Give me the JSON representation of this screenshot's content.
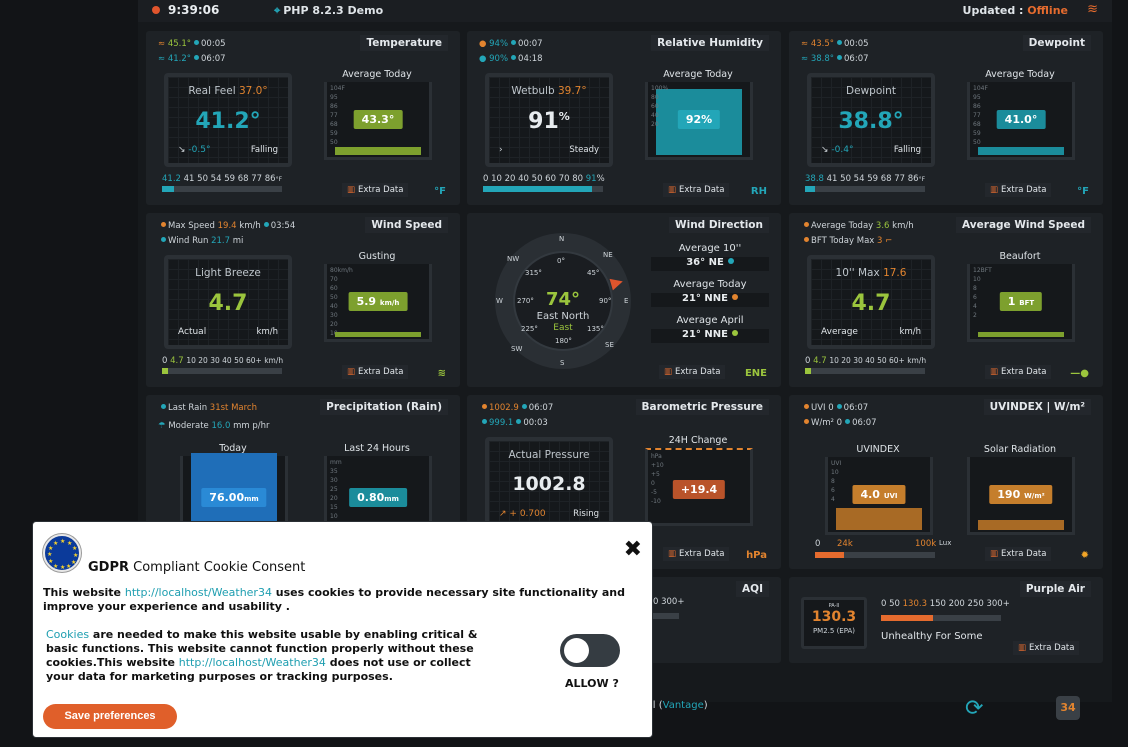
{
  "topbar": {
    "time": "9:39:06",
    "php": "PHP 8.2.3 Demo",
    "updated_label": "Updated :",
    "status": "Offline"
  },
  "temperature": {
    "title": "Temperature",
    "hi_line": "45.1°",
    "hi_time": "00:05",
    "lo_line": "41.2°",
    "lo_time": "06:07",
    "header": "Real Feel",
    "header_val": "37.0°",
    "value": "41.2°",
    "trend": "-0.5°",
    "trend_label": "Falling",
    "gauge_title": "Average Today",
    "gauge_val": "43.3°",
    "scale_pre": "41.2",
    "scale": "41 50 54 59 68 77 86",
    "scale_unit": "°F",
    "gauge_scale": [
      "104F",
      "95",
      "86",
      "77",
      "68",
      "59",
      "50"
    ],
    "fill_pct": 0.1,
    "extra": "Extra Data",
    "unit": "°F"
  },
  "humidity": {
    "title": "Relative Humidity",
    "hi_line": "94%",
    "hi_time": "00:07",
    "lo_line": "90%",
    "lo_time": "04:18",
    "header": "Wetbulb",
    "header_val": "39.7°",
    "value": "91",
    "value_unit": "%",
    "trend_label": "Steady",
    "gauge_title": "Average Today",
    "gauge_val": "92%",
    "scale": "0 10 20 40 50 60 70 80",
    "scale_val": "91",
    "scale_unit": "%",
    "gauge_scale": [
      "100%",
      "80",
      "60",
      "40",
      "20"
    ],
    "fill_pct": 0.91,
    "extra": "Extra Data",
    "unit": "RH"
  },
  "dewpoint": {
    "title": "Dewpoint",
    "hi_line": "43.5°",
    "hi_time": "00:05",
    "lo_line": "38.8°",
    "lo_time": "06:07",
    "header": "Dewpoint",
    "value": "38.8°",
    "trend": "-0.4°",
    "trend_label": "Falling",
    "gauge_title": "Average Today",
    "gauge_val": "41.0°",
    "scale_pre": "38.8",
    "scale": "41 50 54 59 68 77 86",
    "scale_unit": "°F",
    "gauge_scale": [
      "104F",
      "95",
      "86",
      "77",
      "68",
      "59",
      "50"
    ],
    "fill_pct": 0.08,
    "extra": "Extra Data",
    "unit": "°F"
  },
  "wind": {
    "title": "Wind Speed",
    "max_label": "Max Speed",
    "max_val": "19.4",
    "max_unit": "km/h",
    "max_time": "03:54",
    "run_label": "Wind Run",
    "run_val": "21.7",
    "run_unit": "mi",
    "header": "Light Breeze",
    "value": "4.7",
    "bl": "Actual",
    "br": "km/h",
    "gauge_title": "Gusting",
    "gauge_val": "5.9",
    "gauge_unit": "km/h",
    "scale_pre": "0",
    "scale_val": "4.7",
    "scale": "10 20 30 40 50 60+ km/h",
    "gauge_scale": [
      "80km/h",
      "70",
      "60",
      "50",
      "40",
      "30",
      "20",
      "10"
    ],
    "fill_pct": 0.05,
    "extra": "Extra Data"
  },
  "winddir": {
    "title": "Wind Direction",
    "degrees": "74°",
    "dir1": "East North",
    "dir2": "East",
    "points": {
      "n": "N",
      "ne": "NE",
      "e": "E",
      "se": "SE",
      "s": "S",
      "sw": "SW",
      "w": "W",
      "nw": "NW"
    },
    "degs": {
      "d0": "0°",
      "d45": "45°",
      "d90": "90°",
      "d135": "135°",
      "d180": "180°",
      "d225": "225°",
      "d270": "270°",
      "d315": "315°"
    },
    "avg10_label": "Average 10''",
    "avg10_val": "36°  NE",
    "avgtoday_label": "Average Today",
    "avgtoday_val": "21°  NNE",
    "avgapril_label": "Average April",
    "avgapril_val": "21°  NNE",
    "extra": "Extra Data",
    "unit": "ENE"
  },
  "avgwind": {
    "title": "Average Wind Speed",
    "today_label": "Average Today",
    "today_val": "3.6",
    "today_unit": "km/h",
    "bft_label": "BFT Today Max",
    "bft_val": "3",
    "header": "10'' Max",
    "header_val": "17.6",
    "value": "4.7",
    "bl": "Average",
    "br": "km/h",
    "gauge_title": "Beaufort",
    "gauge_val": "1",
    "gauge_unit": "BFT",
    "scale_pre": "0",
    "scale_val": "4.7",
    "scale": "10 20 30 40 50 60+ km/h",
    "gauge_scale": [
      "12BFT",
      "10",
      "8",
      "6",
      "4",
      "2"
    ],
    "fill_pct": 0.05,
    "extra": "Extra Data"
  },
  "rain": {
    "title": "Precipitation (Rain)",
    "last_label": "Last Rain",
    "last_val": "31st March",
    "mod_label": "Moderate",
    "mod_val": "16.0",
    "mod_unit": "mm p/hr",
    "today_title": "Today",
    "today_val": "76.00",
    "today_unit": "mm",
    "last24_title": "Last 24 Hours",
    "last24_val": "0.80",
    "last24_unit": "mm",
    "last24_scale": [
      "mm",
      "35",
      "30",
      "25",
      "20",
      "15",
      "10"
    ]
  },
  "pressure": {
    "title": "Barometric Pressure",
    "hi_line": "1002.9",
    "hi_time": "06:07",
    "lo_line": "999.1",
    "lo_time": "00:03",
    "header": "Actual Pressure",
    "value": "1002.8",
    "trend": "+ 0.700",
    "trend_label": "Rising",
    "gauge_title": "24H Change",
    "gauge_val": "+19.4",
    "gauge_scale": [
      "hPa",
      "+10",
      "+5",
      "0",
      "-5",
      "-10"
    ],
    "extra": "Extra Data",
    "unit": "hPa"
  },
  "uv": {
    "title": "UVINDEX | W/m²",
    "uv_line": "UVI 0",
    "uv_time": "06:07",
    "w_line": "W/m² 0",
    "w_time": "06:07",
    "uv_title": "UVINDEX",
    "uv_val": "4.0",
    "uv_unit": "UVI",
    "uv_scale": [
      "UVI",
      "10",
      "8",
      "6",
      "4"
    ],
    "sol_title": "Solar Radiation",
    "sol_val": "190",
    "sol_unit": "W/m²",
    "scale_a": "0",
    "scale_b": "24k",
    "scale_c": "100k",
    "scale_unit": "Lux",
    "fill_pct": 0.24,
    "extra": "Extra Data"
  },
  "aqi": {
    "title": "AQI",
    "scale": "0 300+"
  },
  "purpleair": {
    "title": "Purple Air",
    "badge": "PA-II",
    "value": "130.3",
    "sub": "PM2.5 (EPA)",
    "scale_pre": "0 50",
    "scale_val": "130.3",
    "scale_post": "150 200 250 300+",
    "fill_pct": 0.43,
    "status": "Unhealthy For Some",
    "extra": "Extra Data"
  },
  "footer": {
    "station_tail": "ll (",
    "station_link": "Vantage",
    "station_close": ")",
    "logo_text": "34"
  },
  "cookie": {
    "title_bold": "GDPR",
    "title_rest": " Compliant Cookie Consent",
    "p1_a": "This website ",
    "p1_link": "http://localhost/Weather34",
    "p1_b": " uses cookies to provide necessary site functionality and improve your experience and usability .",
    "p2_link": "Cookies",
    "p2_a": " are needed to make this website usable by enabling critical & basic functions. This website cannot function properly without these cookies.This website ",
    "p2_link2": "http://localhost/Weather34",
    "p2_b": " does not use or collect your data for marketing purposes or tracking purposes.",
    "allow": "ALLOW ?",
    "save": "Save preferences"
  },
  "colors": {
    "accent": "#23a6b8",
    "orange": "#e2842f",
    "green": "#9bc53d",
    "button": "#e05f2a"
  }
}
